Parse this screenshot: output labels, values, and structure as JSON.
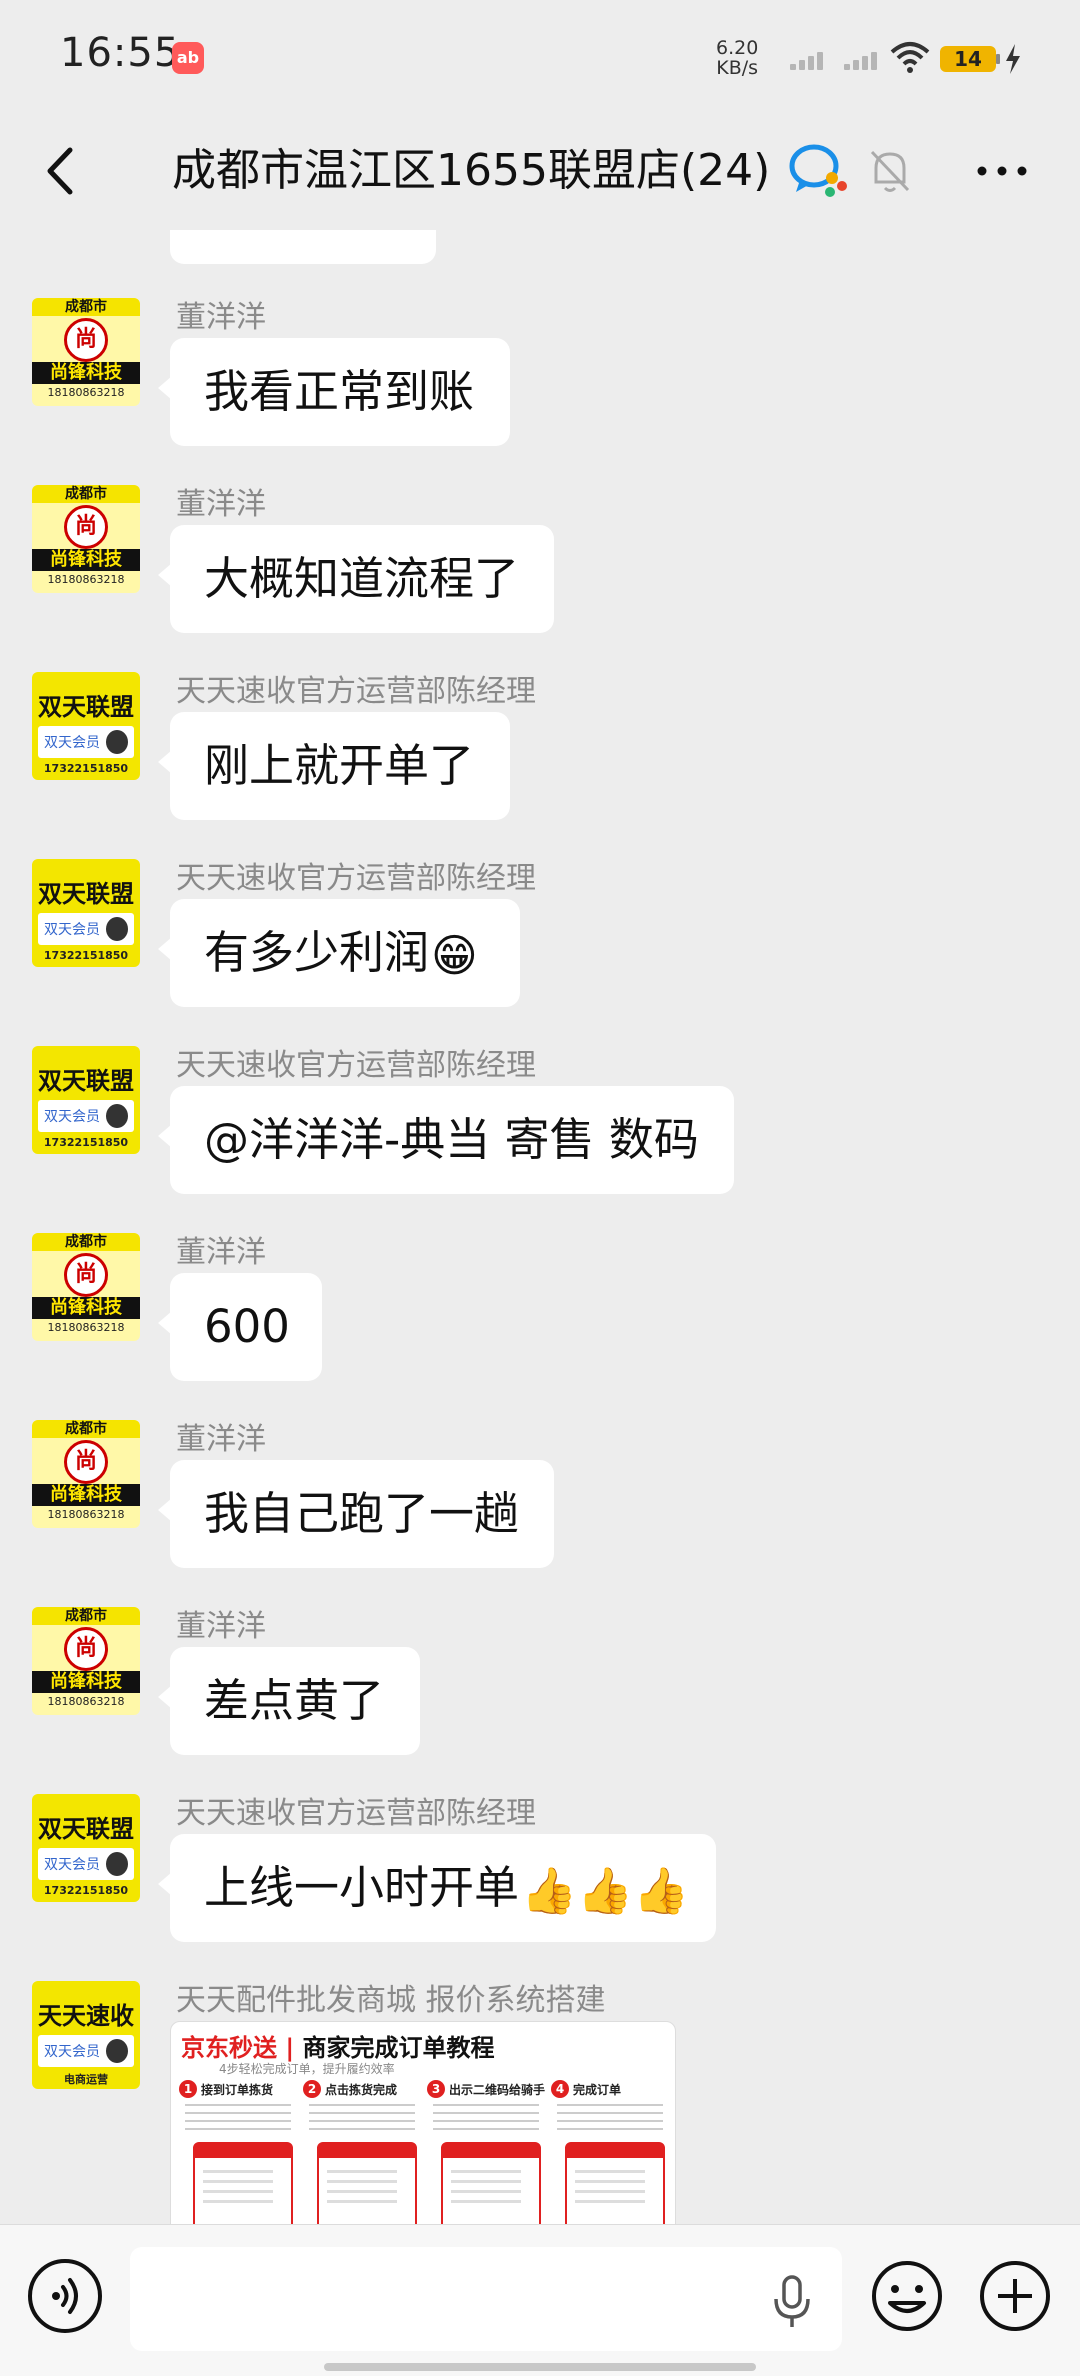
{
  "status_bar": {
    "time": "16:55",
    "app_badge": "ab",
    "speed_value": "6.20",
    "speed_unit": "KB/s",
    "battery": "14"
  },
  "header": {
    "title": "成都市温江区1655联盟店(24)"
  },
  "avatars": {
    "shangfeng": {
      "top": "成都市",
      "seal": "尚",
      "name": "尚锋科技",
      "phone": "18180863218"
    },
    "shuangtian": {
      "name": "双天联盟",
      "card": "双天会员",
      "phone": "17322151850"
    },
    "tiantian": {
      "name": "天天速收",
      "card": "双天会员",
      "phone": "电商运营"
    }
  },
  "messages": [
    {
      "sender": "董洋洋",
      "text": "我看正常到账",
      "avatar": "shangfeng"
    },
    {
      "sender": "董洋洋",
      "text": "大概知道流程了",
      "avatar": "shangfeng"
    },
    {
      "sender": "天天速收官方运营部陈经理",
      "text": "刚上就开单了",
      "avatar": "shuangtian"
    },
    {
      "sender": "天天速收官方运营部陈经理",
      "text": "有多少利润",
      "emoji": "😁",
      "avatar": "shuangtian"
    },
    {
      "sender": "天天速收官方运营部陈经理",
      "text": "@洋洋洋-典当 寄售 数码",
      "avatar": "shuangtian"
    },
    {
      "sender": "董洋洋",
      "text": "600",
      "avatar": "shangfeng"
    },
    {
      "sender": "董洋洋",
      "text": "我自己跑了一趟",
      "avatar": "shangfeng"
    },
    {
      "sender": "董洋洋",
      "text": "差点黄了",
      "avatar": "shangfeng"
    },
    {
      "sender": "天天速收官方运营部陈经理",
      "text": "上线一小时开单",
      "emoji": "👍👍👍",
      "avatar": "shuangtian"
    },
    {
      "sender": "天天配件批发商城 报价系统搭建",
      "avatar": "tiantian",
      "image": {
        "brand": "京东秒送",
        "title": "商家完成订单教程",
        "subtitle": "4步轻松完成订单，提升履约效率",
        "steps": [
          "接到订单拣货",
          "点击拣货完成",
          "出示二维码给骑手",
          "完成订单"
        ]
      }
    }
  ],
  "input": {
    "placeholder": ""
  }
}
